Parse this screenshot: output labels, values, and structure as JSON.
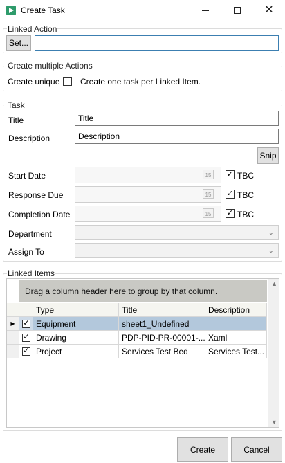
{
  "window": {
    "title": "Create Task"
  },
  "linked_action": {
    "label": "Linked Action",
    "set_button": "Set...",
    "value": ""
  },
  "multiple": {
    "label": "Create multiple Actions",
    "unique_label": "Create unique",
    "unique_checked": false,
    "hint": "Create one task per Linked Item."
  },
  "task": {
    "label": "Task",
    "title_label": "Title",
    "title_value": "Title",
    "description_label": "Description",
    "description_value": "Description",
    "snip_button": "Snip",
    "start_date_label": "Start Date",
    "response_due_label": "Response Due",
    "completion_date_label": "Completion Date",
    "tbc_label": "TBC",
    "calendar_day": "15",
    "department_label": "Department",
    "assign_to_label": "Assign To"
  },
  "linked_items": {
    "label": "Linked Items",
    "group_hint": "Drag a column header here to group by that column.",
    "columns": [
      "Type",
      "Title",
      "Description"
    ],
    "rows": [
      {
        "checked": true,
        "type": "Equipment",
        "title": "sheet1_Undefined",
        "description": ""
      },
      {
        "checked": true,
        "type": "Drawing",
        "title": "PDP-PID-PR-00001-...",
        "description": "Xaml"
      },
      {
        "checked": true,
        "type": "Project",
        "title": "Services Test Bed",
        "description": "Services Test..."
      }
    ]
  },
  "footer": {
    "create": "Create",
    "cancel": "Cancel"
  }
}
